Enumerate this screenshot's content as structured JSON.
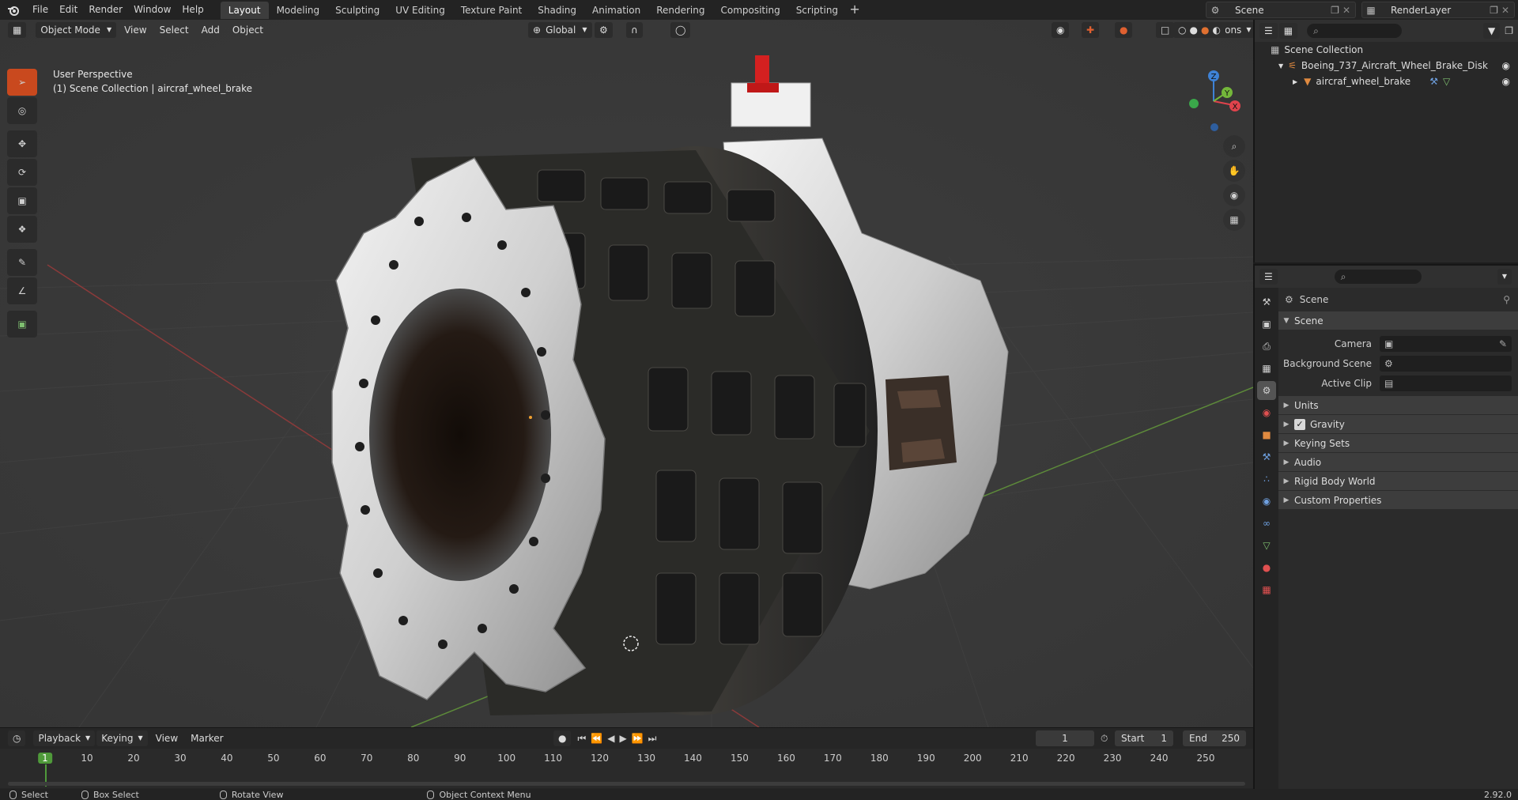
{
  "topbar": {
    "menus": [
      "File",
      "Edit",
      "Render",
      "Window",
      "Help"
    ],
    "workspaces": [
      "Layout",
      "Modeling",
      "Sculpting",
      "UV Editing",
      "Texture Paint",
      "Shading",
      "Animation",
      "Rendering",
      "Compositing",
      "Scripting"
    ],
    "active_workspace": "Layout",
    "scene_name": "Scene",
    "view_layer": "RenderLayer"
  },
  "viewport": {
    "mode": "Object Mode",
    "menus": [
      "View",
      "Select",
      "Add",
      "Object"
    ],
    "transform_orientation": "Global",
    "options_label": "Options",
    "perspective_label": "User Perspective",
    "collection_label": "(1) Scene Collection | aircraf_wheel_brake",
    "gizmo_axes": {
      "x": "X",
      "y": "Y",
      "z": "Z"
    },
    "colors": {
      "x_axis": "#e0434c",
      "y_axis": "#74b73a",
      "z_axis": "#3e82d6",
      "active_tool": "#c9491e"
    }
  },
  "tools": [
    "select-box-icon",
    "cursor-icon",
    "move-icon",
    "rotate-icon",
    "scale-icon",
    "transform-icon",
    "annotate-icon",
    "measure-icon",
    "add-cube-icon"
  ],
  "timeline": {
    "menus": [
      "Playback",
      "Keying",
      "View",
      "Marker"
    ],
    "current_frame": "1",
    "start_label": "Start",
    "start": "1",
    "end_label": "End",
    "end": "250",
    "ruler": [
      "1",
      "10",
      "20",
      "30",
      "40",
      "50",
      "60",
      "70",
      "80",
      "90",
      "100",
      "110",
      "120",
      "130",
      "140",
      "150",
      "160",
      "170",
      "180",
      "190",
      "200",
      "210",
      "220",
      "230",
      "240",
      "250"
    ]
  },
  "outliner": {
    "root": "Scene Collection",
    "collection": "Boeing_737_Aircraft_Wheel_Brake_Disk",
    "object": "aircraf_wheel_brake"
  },
  "properties": {
    "title": "Scene",
    "section": "Scene",
    "camera_label": "Camera",
    "background_label": "Background Scene",
    "clip_label": "Active Clip",
    "subsections": [
      "Units",
      "Gravity",
      "Keying Sets",
      "Audio",
      "Rigid Body World",
      "Custom Properties"
    ],
    "gravity_checked": true
  },
  "statusbar": {
    "select": "Select",
    "box_select": "Box Select",
    "rotate": "Rotate View",
    "context": "Object Context Menu",
    "version": "2.92.0"
  }
}
